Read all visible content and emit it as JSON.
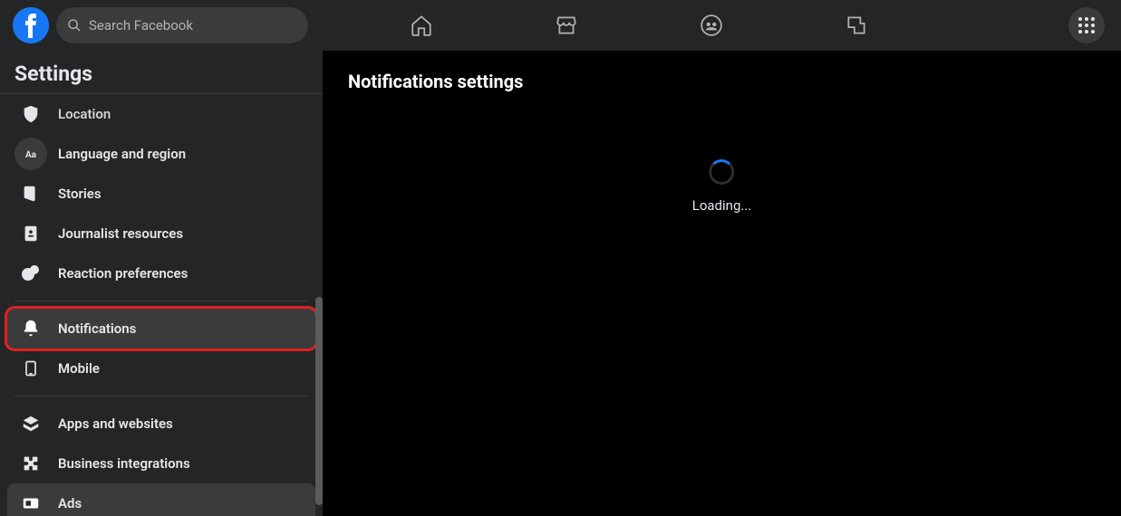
{
  "search": {
    "placeholder": "Search Facebook"
  },
  "sidebar": {
    "title": "Settings",
    "items": [
      {
        "label": "Location"
      },
      {
        "label": "Language and region"
      },
      {
        "label": "Stories"
      },
      {
        "label": "Journalist resources"
      },
      {
        "label": "Reaction preferences"
      },
      {
        "label": "Notifications"
      },
      {
        "label": "Mobile"
      },
      {
        "label": "Apps and websites"
      },
      {
        "label": "Business integrations"
      },
      {
        "label": "Ads"
      }
    ]
  },
  "main": {
    "heading": "Notifications settings",
    "loading_text": "Loading..."
  }
}
